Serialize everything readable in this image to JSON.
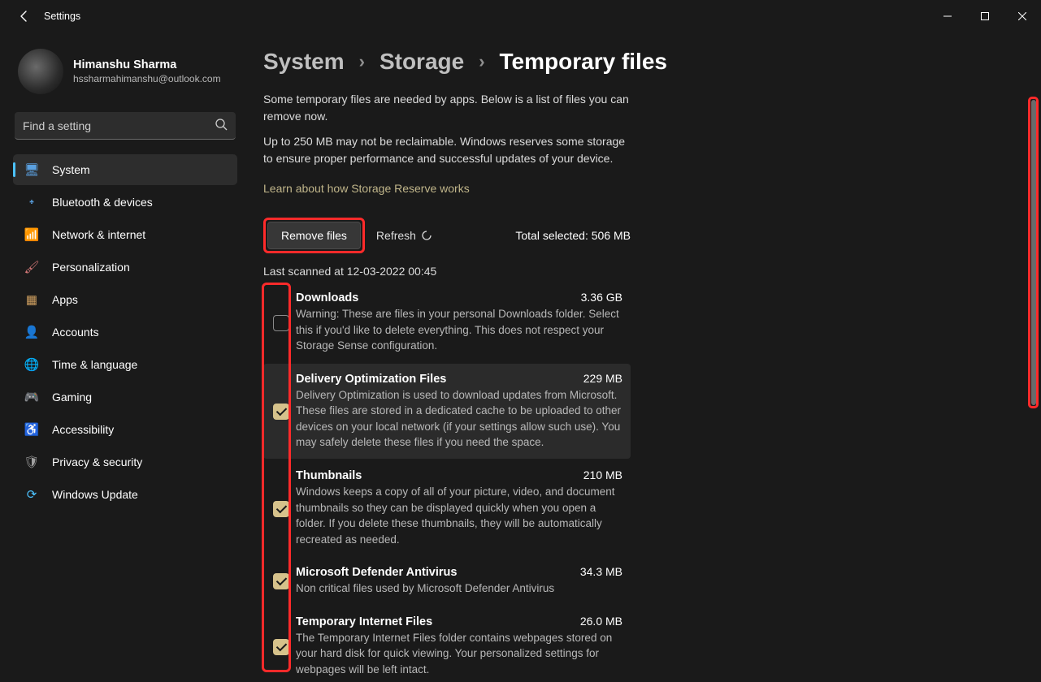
{
  "window": {
    "title": "Settings"
  },
  "profile": {
    "name": "Himanshu Sharma",
    "email": "hssharmahimanshu@outlook.com"
  },
  "search": {
    "placeholder": "Find a setting"
  },
  "nav": [
    {
      "icon": "🖥",
      "cls": "ic-system",
      "label": "System",
      "active": true
    },
    {
      "icon": "᛭",
      "cls": "ic-bt",
      "label": "Bluetooth & devices"
    },
    {
      "icon": "📶",
      "cls": "ic-net",
      "label": "Network & internet"
    },
    {
      "icon": "🖌",
      "cls": "ic-pers",
      "label": "Personalization"
    },
    {
      "icon": "▦",
      "cls": "ic-apps",
      "label": "Apps"
    },
    {
      "icon": "👤",
      "cls": "ic-acc",
      "label": "Accounts"
    },
    {
      "icon": "🌐",
      "cls": "ic-time",
      "label": "Time & language"
    },
    {
      "icon": "🎮",
      "cls": "ic-game",
      "label": "Gaming"
    },
    {
      "icon": "♿",
      "cls": "ic-access",
      "label": "Accessibility"
    },
    {
      "icon": "🛡",
      "cls": "ic-priv",
      "label": "Privacy & security"
    },
    {
      "icon": "⟳",
      "cls": "ic-upd",
      "label": "Windows Update"
    }
  ],
  "breadcrumb": {
    "a": "System",
    "b": "Storage",
    "c": "Temporary files"
  },
  "intro": {
    "p1": "Some temporary files are needed by apps. Below is a list of files you can remove now.",
    "p2": "Up to 250 MB may not be reclaimable. Windows reserves some storage to ensure proper performance and successful updates of your device.",
    "link": "Learn about how Storage Reserve works"
  },
  "actions": {
    "remove": "Remove files",
    "refresh": "Refresh",
    "total_label": "Total selected: 506 MB",
    "scanned": "Last scanned at 12-03-2022 00:45"
  },
  "items": [
    {
      "checked": false,
      "highlight": false,
      "title": "Downloads",
      "size": "3.36 GB",
      "desc": "Warning: These are files in your personal Downloads folder. Select this if you'd like to delete everything. This does not respect your Storage Sense configuration."
    },
    {
      "checked": true,
      "highlight": true,
      "title": "Delivery Optimization Files",
      "size": "229 MB",
      "desc": "Delivery Optimization is used to download updates from Microsoft. These files are stored in a dedicated cache to be uploaded to other devices on your local network (if your settings allow such use). You may safely delete these files if you need the space."
    },
    {
      "checked": true,
      "highlight": false,
      "title": "Thumbnails",
      "size": "210 MB",
      "desc": "Windows keeps a copy of all of your picture, video, and document thumbnails so they can be displayed quickly when you open a folder. If you delete these thumbnails, they will be automatically recreated as needed."
    },
    {
      "checked": true,
      "highlight": false,
      "title": "Microsoft Defender Antivirus",
      "size": "34.3 MB",
      "desc": "Non critical files used by Microsoft Defender Antivirus"
    },
    {
      "checked": true,
      "highlight": false,
      "title": "Temporary Internet Files",
      "size": "26.0 MB",
      "desc": "The Temporary Internet Files folder contains webpages stored on your hard disk for quick viewing. Your personalized settings for webpages will be left intact."
    }
  ]
}
